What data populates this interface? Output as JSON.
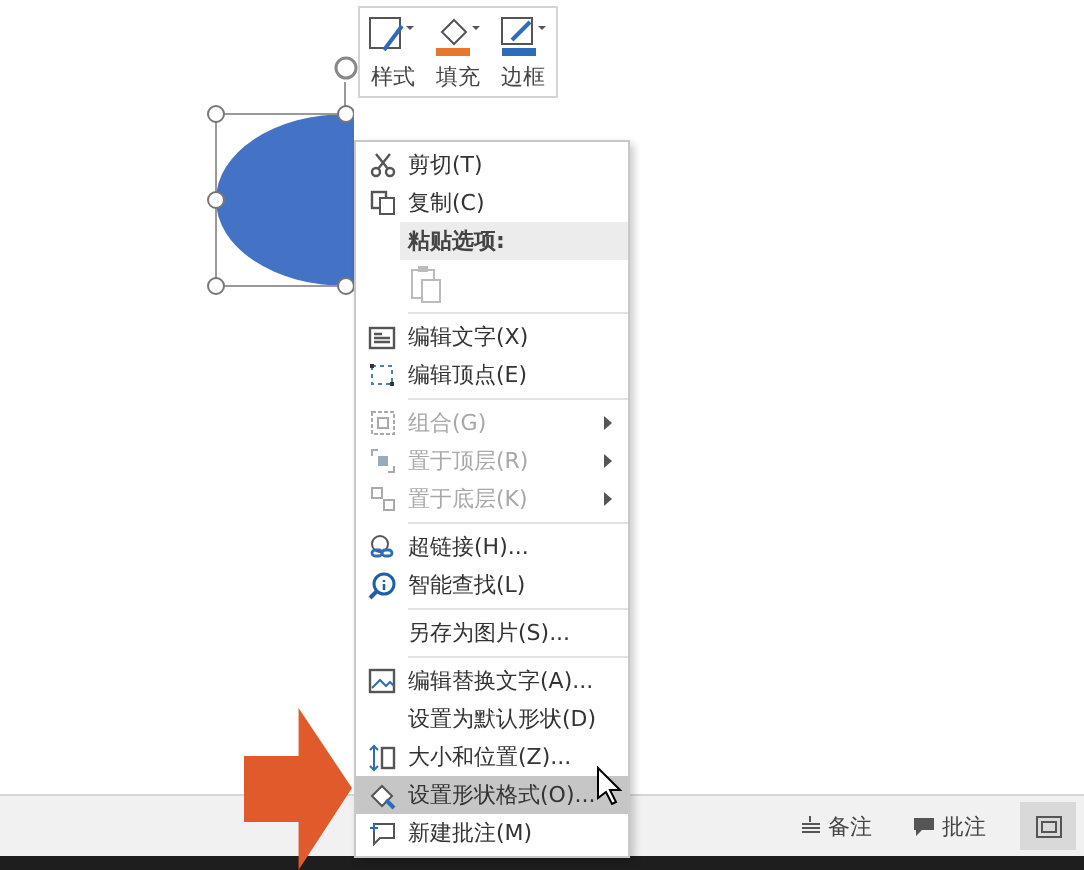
{
  "mini_toolbar": {
    "buttons": [
      {
        "label": "样式"
      },
      {
        "label": "填充"
      },
      {
        "label": "边框"
      }
    ]
  },
  "context_menu": {
    "items": [
      {
        "kind": "item",
        "label": "剪切(T)",
        "disabled": false,
        "submenu": false,
        "selected": false
      },
      {
        "kind": "item",
        "label": "复制(C)",
        "disabled": false,
        "submenu": false,
        "selected": false
      },
      {
        "kind": "header",
        "label": "粘贴选项:"
      },
      {
        "kind": "paste",
        "disabled": true
      },
      {
        "kind": "separator"
      },
      {
        "kind": "item",
        "label": "编辑文字(X)",
        "disabled": false,
        "submenu": false,
        "selected": false
      },
      {
        "kind": "item",
        "label": "编辑顶点(E)",
        "disabled": false,
        "submenu": false,
        "selected": false
      },
      {
        "kind": "separator"
      },
      {
        "kind": "item",
        "label": "组合(G)",
        "disabled": true,
        "submenu": true,
        "selected": false
      },
      {
        "kind": "item",
        "label": "置于顶层(R)",
        "disabled": true,
        "submenu": true,
        "selected": false
      },
      {
        "kind": "item",
        "label": "置于底层(K)",
        "disabled": true,
        "submenu": true,
        "selected": false
      },
      {
        "kind": "separator"
      },
      {
        "kind": "item",
        "label": "超链接(H)...",
        "disabled": false,
        "submenu": false,
        "selected": false
      },
      {
        "kind": "item",
        "label": "智能查找(L)",
        "disabled": false,
        "submenu": false,
        "selected": false
      },
      {
        "kind": "separator"
      },
      {
        "kind": "item",
        "label": "另存为图片(S)...",
        "disabled": false,
        "submenu": false,
        "selected": false
      },
      {
        "kind": "separator"
      },
      {
        "kind": "item",
        "label": "编辑替换文字(A)...",
        "disabled": false,
        "submenu": false,
        "selected": false
      },
      {
        "kind": "item",
        "label": "设置为默认形状(D)",
        "disabled": false,
        "submenu": false,
        "selected": false
      },
      {
        "kind": "item",
        "label": "大小和位置(Z)...",
        "disabled": false,
        "submenu": false,
        "selected": false
      },
      {
        "kind": "item",
        "label": "设置形状格式(O)...",
        "disabled": false,
        "submenu": false,
        "selected": true
      },
      {
        "kind": "item",
        "label": "新建批注(M)",
        "disabled": false,
        "submenu": false,
        "selected": false
      }
    ]
  },
  "status_bar": {
    "buttons": [
      {
        "label": "备注"
      },
      {
        "label": "批注"
      }
    ]
  }
}
